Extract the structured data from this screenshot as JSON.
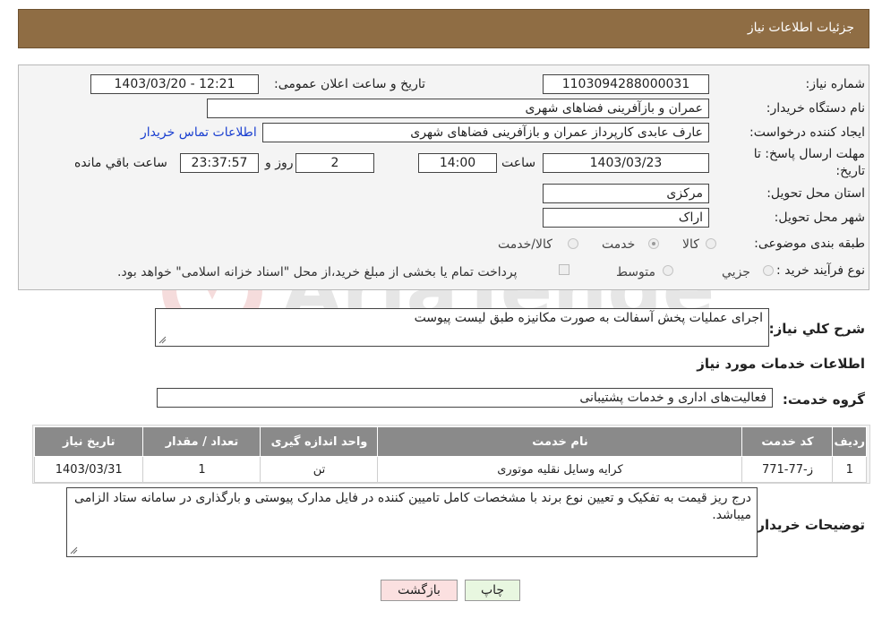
{
  "header": {
    "title": "جزئیات اطلاعات نیاز"
  },
  "form": {
    "need_number_label": "شماره نیاز:",
    "need_number": "1103094288000031",
    "announce_label": "تاریخ و ساعت اعلان عمومی:",
    "announce_value": "1403/03/20 - 12:21",
    "buyer_label": "نام دستگاه خریدار:",
    "buyer_value": "عمران و بازآفرینی فضاهای شهری",
    "creator_label": "ایجاد کننده درخواست:",
    "creator_value": "عارف عابدی کارپرداز عمران و بازآفرینی فضاهای شهری",
    "contact_link": "اطلاعات تماس خریدار",
    "deadline_label_1": "مهلت ارسال پاسخ: تا",
    "deadline_label_2": "تاریخ:",
    "deadline_date": "1403/03/23",
    "time_label": "ساعت",
    "deadline_time": "14:00",
    "days_value": "2",
    "days_label": "روز و",
    "remaining_time": "23:37:57",
    "remaining_label": "ساعت باقي مانده",
    "province_label": "استان محل تحویل:",
    "province_value": "مرکزی",
    "city_label": "شهر محل تحویل:",
    "city_value": "اراک",
    "category_label": "طبقه بندی موضوعی:",
    "category_options": [
      "کالا",
      "خدمت",
      "کالا/خدمت"
    ],
    "category_selected": "خدمت",
    "process_label": "نوع فرآیند خرید :",
    "process_options": [
      "جزیي",
      "متوسط"
    ],
    "payment_note": "پرداخت تمام یا بخشی از مبلغ خرید،از محل \"اسناد خزانه اسلامی\" خواهد بود."
  },
  "summary": {
    "label": "شرح کلي نياز:",
    "value": "اجرای عملیات پخش آسفالت به صورت مکانیزه طبق لیست پیوست"
  },
  "services_section": {
    "title": "اطلاعات خدمات مورد نیاز",
    "group_label": "گروه خدمت:",
    "group_value": "فعالیت‌های اداری و خدمات پشتیبانی"
  },
  "table": {
    "headers": [
      "ردیف",
      "کد خدمت",
      "نام خدمت",
      "واحد اندازه گیری",
      "تعداد / مقدار",
      "تاریخ نیاز"
    ],
    "rows": [
      [
        "1",
        "ز-77-771",
        "کرایه وسایل نقلیه موتوری",
        "تن",
        "1",
        "1403/03/31"
      ]
    ]
  },
  "buyer_notes": {
    "label": "توضیحات خریدار:",
    "value": "درج ریز قیمت به تفکیک و تعیین نوع برند با مشخصات کامل تامیین کننده در فایل مدارک پیوستی و بارگذاری در سامانه ستاد الزامی میباشد."
  },
  "buttons": {
    "print": "چاپ",
    "back": "بازگشت"
  },
  "colors": {
    "header_bg": "#8f6d44",
    "print_btn": "#e8f7e0",
    "back_btn": "#fbe0e0",
    "link": "#1a3fd0"
  }
}
